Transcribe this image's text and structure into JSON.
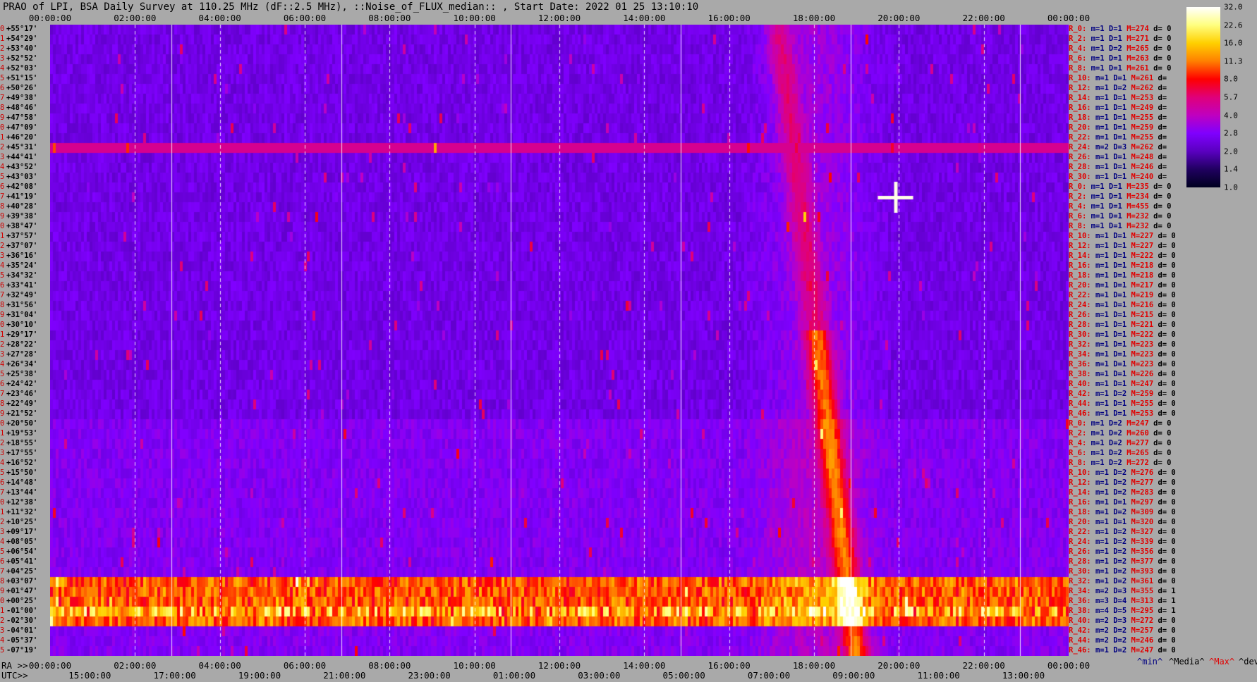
{
  "title": "PRAO of LPI, BSA Daily Survey at 110.25 MHz (dF::2.5 MHz), ::Noise_of_FLUX_median:: , Start Date: 2022 01 25 13:10:10",
  "axis": {
    "ra_label": "RA >>",
    "utc_label": "UTC>>",
    "top_ticks": [
      "00:00:00",
      "02:00:00",
      "04:00:00",
      "06:00:00",
      "08:00:00",
      "10:00:00",
      "12:00:00",
      "14:00:00",
      "16:00:00",
      "18:00:00",
      "20:00:00",
      "22:00:00",
      "00:00:00"
    ],
    "bottom_ra_ticks": [
      "00:00:00",
      "02:00:00",
      "04:00:00",
      "06:00:00",
      "08:00:00",
      "10:00:00",
      "12:00:00",
      "14:00:00",
      "16:00:00",
      "18:00:00",
      "20:00:00",
      "22:00:00",
      "00:00:00"
    ],
    "bottom_utc_ticks": [
      "15:00:00",
      "17:00:00",
      "19:00:00",
      "21:00:00",
      "23:00:00",
      "01:00:00",
      "03:00:00",
      "05:00:00",
      "07:00:00",
      "09:00:00",
      "11:00:00",
      "13:00:00"
    ]
  },
  "declinations": [
    "+55°17'",
    "+54°29'",
    "+53°40'",
    "+52°52'",
    "+52°03'",
    "+51°15'",
    "+50°26'",
    "+49°38'",
    "+48°46'",
    "+47°58'",
    "+47°09'",
    "+46°20'",
    "+45°31'",
    "+44°41'",
    "+43°52'",
    "+43°03'",
    "+42°08'",
    "+41°19'",
    "+40°28'",
    "+39°38'",
    "+38°47'",
    "+37°57'",
    "+37°07'",
    "+36°16'",
    "+35°24'",
    "+34°32'",
    "+33°41'",
    "+32°49'",
    "+31°56'",
    "+31°04'",
    "+30°10'",
    "+29°17'",
    "+28°22'",
    "+27°28'",
    "+26°34'",
    "+25°38'",
    "+24°42'",
    "+23°46'",
    "+22°49'",
    "+21°52'",
    "+20°50'",
    "+19°53'",
    "+18°55'",
    "+17°55'",
    "+16°52'",
    "+15°50'",
    "+14°48'",
    "+13°44'",
    "+12°38'",
    "+11°32'",
    "+10°25'",
    "+09°17'",
    "+08°05'",
    "+06°54'",
    "+05°41'",
    "+04°25'",
    "+03°07'",
    "+01°47'",
    "+00°25'",
    "-01°00'",
    "-02°30'",
    "-04°01'",
    "-05°37'",
    "-07°19'"
  ],
  "row_stats": [
    {
      "r": "R_0:",
      "m": "m=1",
      "D": "D=1",
      "M": "M=274",
      "d": "d= 0"
    },
    {
      "r": "R_2:",
      "m": "m=1",
      "D": "D=1",
      "M": "M=271",
      "d": "d= 0"
    },
    {
      "r": "R_4:",
      "m": "m=1",
      "D": "D=2",
      "M": "M=265",
      "d": "d= 0"
    },
    {
      "r": "R_6:",
      "m": "m=1",
      "D": "D=1",
      "M": "M=263",
      "d": "d= 0"
    },
    {
      "r": "R_8:",
      "m": "m=1",
      "D": "D=1",
      "M": "M=261",
      "d": "d= 0"
    },
    {
      "r": "R_10:",
      "m": "m=1",
      "D": "D=1",
      "M": "M=261",
      "d": "d="
    },
    {
      "r": "R_12:",
      "m": "m=1",
      "D": "D=2",
      "M": "M=262",
      "d": "d="
    },
    {
      "r": "R_14:",
      "m": "m=1",
      "D": "D=1",
      "M": "M=253",
      "d": "d="
    },
    {
      "r": "R_16:",
      "m": "m=1",
      "D": "D=1",
      "M": "M=249",
      "d": "d="
    },
    {
      "r": "R_18:",
      "m": "m=1",
      "D": "D=1",
      "M": "M=255",
      "d": "d="
    },
    {
      "r": "R_20:",
      "m": "m=1",
      "D": "D=1",
      "M": "M=259",
      "d": "d="
    },
    {
      "r": "R_22:",
      "m": "m=1",
      "D": "D=1",
      "M": "M=255",
      "d": "d="
    },
    {
      "r": "R_24:",
      "m": "m=2",
      "D": "D=3",
      "M": "M=262",
      "d": "d="
    },
    {
      "r": "R_26:",
      "m": "m=1",
      "D": "D=1",
      "M": "M=248",
      "d": "d="
    },
    {
      "r": "R_28:",
      "m": "m=1",
      "D": "D=1",
      "M": "M=246",
      "d": "d="
    },
    {
      "r": "R_30:",
      "m": "m=1",
      "D": "D=1",
      "M": "M=240",
      "d": "d="
    },
    {
      "r": "R_0:",
      "m": "m=1",
      "D": "D=1",
      "M": "M=235",
      "d": "d= 0"
    },
    {
      "r": "R_2:",
      "m": "m=1",
      "D": "D=1",
      "M": "M=234",
      "d": "d= 0"
    },
    {
      "r": "R_4:",
      "m": "m=1",
      "D": "D=1",
      "M": "M=455",
      "d": "d= 0"
    },
    {
      "r": "R_6:",
      "m": "m=1",
      "D": "D=1",
      "M": "M=232",
      "d": "d= 0"
    },
    {
      "r": "R_8:",
      "m": "m=1",
      "D": "D=1",
      "M": "M=232",
      "d": "d= 0"
    },
    {
      "r": "R_10:",
      "m": "m=1",
      "D": "D=1",
      "M": "M=227",
      "d": "d= 0"
    },
    {
      "r": "R_12:",
      "m": "m=1",
      "D": "D=1",
      "M": "M=227",
      "d": "d= 0"
    },
    {
      "r": "R_14:",
      "m": "m=1",
      "D": "D=1",
      "M": "M=222",
      "d": "d= 0"
    },
    {
      "r": "R_16:",
      "m": "m=1",
      "D": "D=1",
      "M": "M=218",
      "d": "d= 0"
    },
    {
      "r": "R_18:",
      "m": "m=1",
      "D": "D=1",
      "M": "M=218",
      "d": "d= 0"
    },
    {
      "r": "R_20:",
      "m": "m=1",
      "D": "D=1",
      "M": "M=217",
      "d": "d= 0"
    },
    {
      "r": "R_22:",
      "m": "m=1",
      "D": "D=1",
      "M": "M=219",
      "d": "d= 0"
    },
    {
      "r": "R_24:",
      "m": "m=1",
      "D": "D=1",
      "M": "M=216",
      "d": "d= 0"
    },
    {
      "r": "R_26:",
      "m": "m=1",
      "D": "D=1",
      "M": "M=215",
      "d": "d= 0"
    },
    {
      "r": "R_28:",
      "m": "m=1",
      "D": "D=1",
      "M": "M=221",
      "d": "d= 0"
    },
    {
      "r": "R_30:",
      "m": "m=1",
      "D": "D=1",
      "M": "M=222",
      "d": "d= 0"
    },
    {
      "r": "R_32:",
      "m": "m=1",
      "D": "D=1",
      "M": "M=223",
      "d": "d= 0"
    },
    {
      "r": "R_34:",
      "m": "m=1",
      "D": "D=1",
      "M": "M=223",
      "d": "d= 0"
    },
    {
      "r": "R_36:",
      "m": "m=1",
      "D": "D=1",
      "M": "M=223",
      "d": "d= 0"
    },
    {
      "r": "R_38:",
      "m": "m=1",
      "D": "D=1",
      "M": "M=226",
      "d": "d= 0"
    },
    {
      "r": "R_40:",
      "m": "m=1",
      "D": "D=1",
      "M": "M=247",
      "d": "d= 0"
    },
    {
      "r": "R_42:",
      "m": "m=1",
      "D": "D=2",
      "M": "M=259",
      "d": "d= 0"
    },
    {
      "r": "R_44:",
      "m": "m=1",
      "D": "D=1",
      "M": "M=255",
      "d": "d= 0"
    },
    {
      "r": "R_46:",
      "m": "m=1",
      "D": "D=1",
      "M": "M=253",
      "d": "d= 0"
    },
    {
      "r": "R_0:",
      "m": "m=1",
      "D": "D=2",
      "M": "M=247",
      "d": "d= 0"
    },
    {
      "r": "R_2:",
      "m": "m=1",
      "D": "D=2",
      "M": "M=260",
      "d": "d= 0"
    },
    {
      "r": "R_4:",
      "m": "m=1",
      "D": "D=2",
      "M": "M=277",
      "d": "d= 0"
    },
    {
      "r": "R_6:",
      "m": "m=1",
      "D": "D=2",
      "M": "M=265",
      "d": "d= 0"
    },
    {
      "r": "R_8:",
      "m": "m=1",
      "D": "D=2",
      "M": "M=272",
      "d": "d= 0"
    },
    {
      "r": "R_10:",
      "m": "m=1",
      "D": "D=2",
      "M": "M=276",
      "d": "d= 0"
    },
    {
      "r": "R_12:",
      "m": "m=1",
      "D": "D=2",
      "M": "M=277",
      "d": "d= 0"
    },
    {
      "r": "R_14:",
      "m": "m=1",
      "D": "D=2",
      "M": "M=283",
      "d": "d= 0"
    },
    {
      "r": "R_16:",
      "m": "m=1",
      "D": "D=1",
      "M": "M=297",
      "d": "d= 0"
    },
    {
      "r": "R_18:",
      "m": "m=1",
      "D": "D=2",
      "M": "M=309",
      "d": "d= 0"
    },
    {
      "r": "R_20:",
      "m": "m=1",
      "D": "D=1",
      "M": "M=320",
      "d": "d= 0"
    },
    {
      "r": "R_22:",
      "m": "m=1",
      "D": "D=2",
      "M": "M=327",
      "d": "d= 0"
    },
    {
      "r": "R_24:",
      "m": "m=1",
      "D": "D=2",
      "M": "M=339",
      "d": "d= 0"
    },
    {
      "r": "R_26:",
      "m": "m=1",
      "D": "D=2",
      "M": "M=356",
      "d": "d= 0"
    },
    {
      "r": "R_28:",
      "m": "m=1",
      "D": "D=2",
      "M": "M=377",
      "d": "d= 0"
    },
    {
      "r": "R_30:",
      "m": "m=1",
      "D": "D=2",
      "M": "M=393",
      "d": "d= 0"
    },
    {
      "r": "R_32:",
      "m": "m=1",
      "D": "D=2",
      "M": "M=361",
      "d": "d= 0"
    },
    {
      "r": "R_34:",
      "m": "m=2",
      "D": "D=3",
      "M": "M=355",
      "d": "d= 1"
    },
    {
      "r": "R_36:",
      "m": "m=3",
      "D": "D=4",
      "M": "M=313",
      "d": "d= 1"
    },
    {
      "r": "R_38:",
      "m": "m=4",
      "D": "D=5",
      "M": "M=295",
      "d": "d= 1"
    },
    {
      "r": "R_40:",
      "m": "m=2",
      "D": "D=3",
      "M": "M=272",
      "d": "d= 0"
    },
    {
      "r": "R_42:",
      "m": "m=2",
      "D": "D=2",
      "M": "M=257",
      "d": "d= 0"
    },
    {
      "r": "R_44:",
      "m": "m=2",
      "D": "D=2",
      "M": "M=246",
      "d": "d= 0"
    },
    {
      "r": "R_46:",
      "m": "m=1",
      "D": "D=2",
      "M": "M=247",
      "d": "d= 0"
    }
  ],
  "colorbar": {
    "labels": [
      "32.0",
      "22.6",
      "16.0",
      "11.3",
      "8.0",
      "5.7",
      "4.0",
      "2.8",
      "2.0",
      "1.4",
      "1.0"
    ],
    "stops": [
      "#ffffff",
      "#ffff80",
      "#ffd000",
      "#ff8000",
      "#ff0000",
      "#e0007a",
      "#c000c0",
      "#8000ff",
      "#5a00c0",
      "#200060",
      "#000020"
    ]
  },
  "legend": {
    "min": "^min^",
    "median": "^Media^",
    "max": "^Max^",
    "devia": "^devia"
  },
  "chart_data": {
    "type": "heatmap",
    "title": "PRAO of LPI, BSA Daily Survey at 110.25 MHz (dF::2.5 MHz), ::Noise_of_FLUX_median:: , Start Date: 2022 01 25 13:10:10",
    "x": "Right ascension 00:00:00 to 24:00:00 (UTC 13:10 to 13:10 next day)",
    "rows": 64,
    "scale": [
      1.0,
      32.0
    ],
    "features": [
      {
        "label": "bright horizontal band near dec -01°00'",
        "value_range": "8-32"
      },
      {
        "label": "horizontal line at dec +45°31'",
        "value_range": "4-5.7"
      },
      {
        "label": "galactic plane crossing near RA 19:30-20:00",
        "value_range": "5.7-32"
      },
      {
        "label": "bright source near RA 19:55 dec +41°19'",
        "value": 32
      }
    ]
  },
  "colors": {
    "bg": "#a9a9a9",
    "label_red": "#e00000",
    "label_blue": "#000080"
  }
}
